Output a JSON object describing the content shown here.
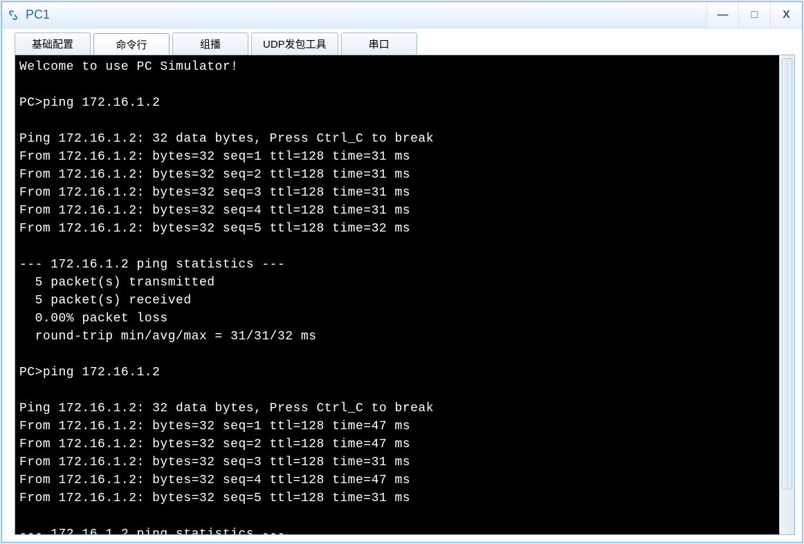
{
  "window": {
    "title": "PC1"
  },
  "tabs": [
    {
      "label": "基础配置",
      "active": false
    },
    {
      "label": "命令行",
      "active": true
    },
    {
      "label": "组播",
      "active": false
    },
    {
      "label": "UDP发包工具",
      "active": false
    },
    {
      "label": "串口",
      "active": false
    }
  ],
  "win_buttons": {
    "minimize": "—",
    "maximize": "□",
    "close": "X"
  },
  "terminal": {
    "lines": [
      "Welcome to use PC Simulator!",
      "",
      "PC>ping 172.16.1.2",
      "",
      "Ping 172.16.1.2: 32 data bytes, Press Ctrl_C to break",
      "From 172.16.1.2: bytes=32 seq=1 ttl=128 time=31 ms",
      "From 172.16.1.2: bytes=32 seq=2 ttl=128 time=31 ms",
      "From 172.16.1.2: bytes=32 seq=3 ttl=128 time=31 ms",
      "From 172.16.1.2: bytes=32 seq=4 ttl=128 time=31 ms",
      "From 172.16.1.2: bytes=32 seq=5 ttl=128 time=32 ms",
      "",
      "--- 172.16.1.2 ping statistics ---",
      "  5 packet(s) transmitted",
      "  5 packet(s) received",
      "  0.00% packet loss",
      "  round-trip min/avg/max = 31/31/32 ms",
      "",
      "PC>ping 172.16.1.2",
      "",
      "Ping 172.16.1.2: 32 data bytes, Press Ctrl_C to break",
      "From 172.16.1.2: bytes=32 seq=1 ttl=128 time=47 ms",
      "From 172.16.1.2: bytes=32 seq=2 ttl=128 time=47 ms",
      "From 172.16.1.2: bytes=32 seq=3 ttl=128 time=31 ms",
      "From 172.16.1.2: bytes=32 seq=4 ttl=128 time=47 ms",
      "From 172.16.1.2: bytes=32 seq=5 ttl=128 time=31 ms",
      "",
      "--- 172.16.1.2 ping statistics ---"
    ]
  }
}
